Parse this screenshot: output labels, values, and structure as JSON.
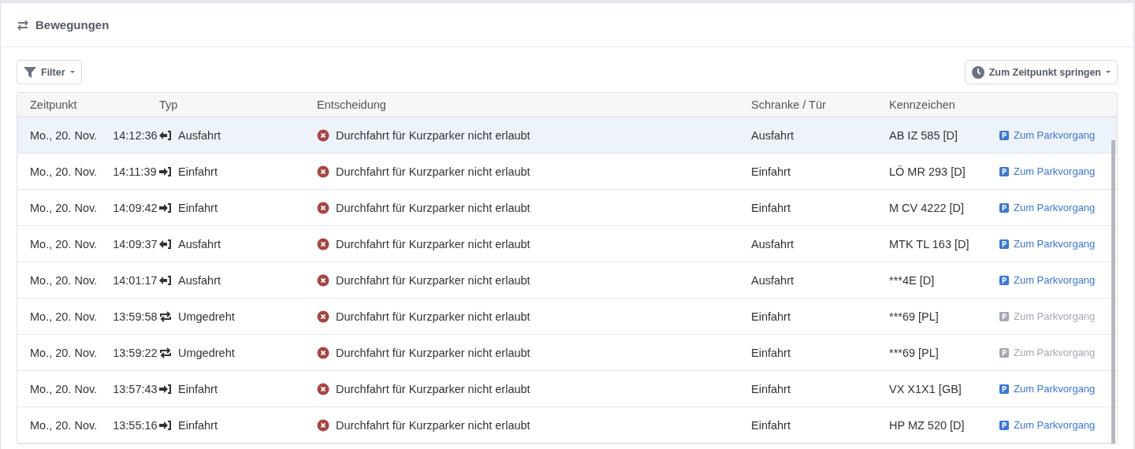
{
  "panel": {
    "title": "Bewegungen"
  },
  "toolbar": {
    "filter_button": "Filter",
    "jump_button": "Zum Zeitpunkt springen"
  },
  "table": {
    "columns": [
      "Zeitpunkt",
      "Typ",
      "Entscheidung",
      "Schranke / Tür",
      "Kennzeichen"
    ],
    "rows": [
      {
        "date": "Mo., 20. Nov.",
        "time": "14:12:36",
        "kind": "exit",
        "type": "Ausfahrt",
        "decision": "Durchfahrt für Kurzparker nicht erlaubt",
        "gate": "Ausfahrt",
        "plate": "AB IZ 585 [D]",
        "link": "Zum Parkvorgang",
        "link_disabled": false,
        "selected": true
      },
      {
        "date": "Mo., 20. Nov.",
        "time": "14:11:39",
        "kind": "entry",
        "type": "Einfahrt",
        "decision": "Durchfahrt für Kurzparker nicht erlaubt",
        "gate": "Einfahrt",
        "plate": "LÖ MR 293 [D]",
        "link": "Zum Parkvorgang",
        "link_disabled": false,
        "selected": false
      },
      {
        "date": "Mo., 20. Nov.",
        "time": "14:09:42",
        "kind": "entry",
        "type": "Einfahrt",
        "decision": "Durchfahrt für Kurzparker nicht erlaubt",
        "gate": "Einfahrt",
        "plate": "M CV 4222 [D]",
        "link": "Zum Parkvorgang",
        "link_disabled": false,
        "selected": false
      },
      {
        "date": "Mo., 20. Nov.",
        "time": "14:09:37",
        "kind": "exit",
        "type": "Ausfahrt",
        "decision": "Durchfahrt für Kurzparker nicht erlaubt",
        "gate": "Ausfahrt",
        "plate": "MTK TL 163 [D]",
        "link": "Zum Parkvorgang",
        "link_disabled": false,
        "selected": false
      },
      {
        "date": "Mo., 20. Nov.",
        "time": "14:01:17",
        "kind": "exit",
        "type": "Ausfahrt",
        "decision": "Durchfahrt für Kurzparker nicht erlaubt",
        "gate": "Ausfahrt",
        "plate": "***4E [D]",
        "link": "Zum Parkvorgang",
        "link_disabled": false,
        "selected": false
      },
      {
        "date": "Mo., 20. Nov.",
        "time": "13:59:58",
        "kind": "turn",
        "type": "Umgedreht",
        "decision": "Durchfahrt für Kurzparker nicht erlaubt",
        "gate": "Einfahrt",
        "plate": "***69 [PL]",
        "link": "Zum Parkvorgang",
        "link_disabled": true,
        "selected": false
      },
      {
        "date": "Mo., 20. Nov.",
        "time": "13:59:22",
        "kind": "turn",
        "type": "Umgedreht",
        "decision": "Durchfahrt für Kurzparker nicht erlaubt",
        "gate": "Einfahrt",
        "plate": "***69 [PL]",
        "link": "Zum Parkvorgang",
        "link_disabled": true,
        "selected": false
      },
      {
        "date": "Mo., 20. Nov.",
        "time": "13:57:43",
        "kind": "entry",
        "type": "Einfahrt",
        "decision": "Durchfahrt für Kurzparker nicht erlaubt",
        "gate": "Einfahrt",
        "plate": "VX X1X1 [GB]",
        "link": "Zum Parkvorgang",
        "link_disabled": false,
        "selected": false
      },
      {
        "date": "Mo., 20. Nov.",
        "time": "13:55:16",
        "kind": "entry",
        "type": "Einfahrt",
        "decision": "Durchfahrt für Kurzparker nicht erlaubt",
        "gate": "Einfahrt",
        "plate": "HP MZ 520 [D]",
        "link": "Zum Parkvorgang",
        "link_disabled": false,
        "selected": false
      }
    ]
  }
}
